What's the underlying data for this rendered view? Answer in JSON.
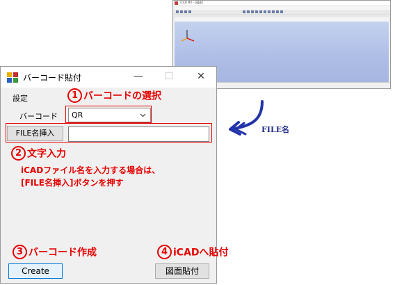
{
  "app_window": {
    "title": "iCAD MX – [図面]",
    "canvas_color": "#b5c4ea"
  },
  "dialog": {
    "title": "バーコード貼付",
    "minimize_glyph": "—",
    "maximize_glyph": "☐",
    "close_glyph": "✕",
    "menu_settings": "設定",
    "barcode_label": "バーコード",
    "barcode_type": {
      "selected": "QR"
    },
    "file_name_button": "FILE名挿入",
    "file_name_input": {
      "value": "",
      "placeholder": ""
    },
    "create_button": "Create",
    "paste_button": "図面貼付"
  },
  "annotations": {
    "step1": {
      "num": "1",
      "text": "バーコードの選択"
    },
    "step2": {
      "num": "2",
      "text": "文字入力"
    },
    "step2_note_line1": "iCADファイル名を入力する場合は、",
    "step2_note_line2": "[FILE名挿入]ボタンを押す",
    "step3": {
      "num": "3",
      "text": "バーコード作成"
    },
    "step4": {
      "num": "4",
      "text": "iCADへ貼付"
    },
    "arrow_label": "FILE名",
    "annotation_color": "#e60000",
    "arrow_color": "#2233aa"
  }
}
